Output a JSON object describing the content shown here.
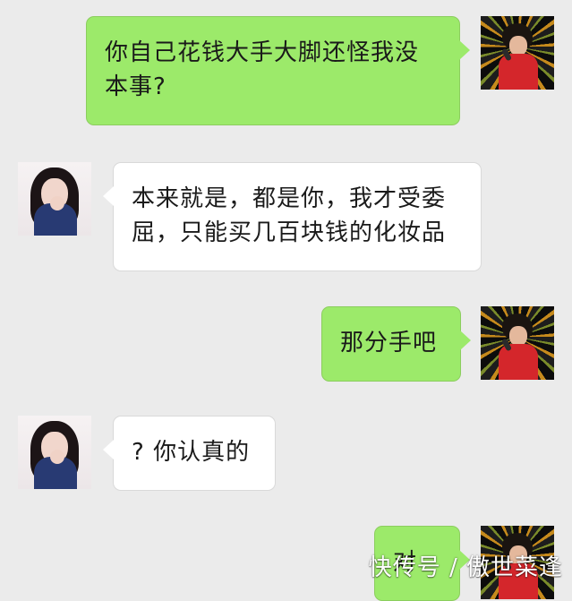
{
  "chat": {
    "messages": [
      {
        "side": "right",
        "text": "你自己花钱大手大脚还怪我没本事?"
      },
      {
        "side": "left",
        "text": "本来就是，都是你，我才受委屈，只能买几百块钱的化妆品"
      },
      {
        "side": "right",
        "text": "那分手吧"
      },
      {
        "side": "left",
        "text": "? 你认真的"
      },
      {
        "side": "right",
        "text": "对"
      }
    ]
  },
  "watermark": {
    "text": "快传号 / 傲世菜逢"
  },
  "colors": {
    "background": "#ebebeb",
    "outgoing_bubble": "#9cea6a",
    "incoming_bubble": "#ffffff"
  },
  "icons": {
    "self_avatar": "avatar-man-icon",
    "contact_avatar": "avatar-girl-icon"
  }
}
